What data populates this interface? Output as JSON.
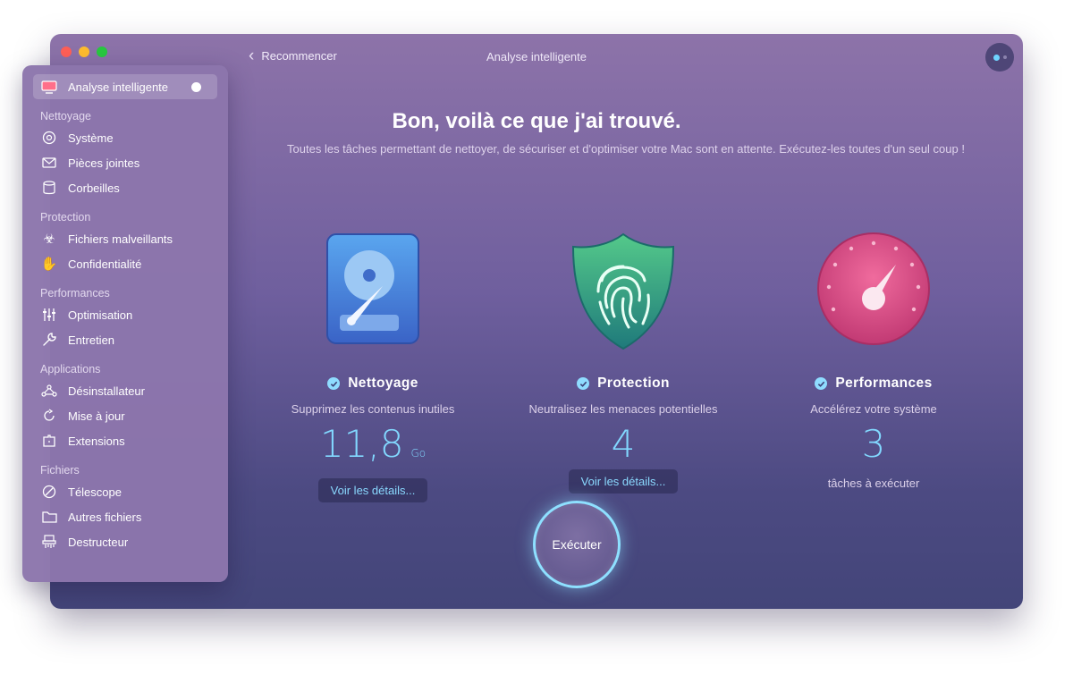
{
  "window": {
    "title": "Analyse intelligente",
    "back_label": "Recommencer"
  },
  "sidebar": {
    "active": {
      "label": "Analyse intelligente",
      "icon": "monitor-icon"
    },
    "sections": [
      {
        "label": "Nettoyage",
        "items": [
          {
            "label": "Système",
            "icon": "system-icon"
          },
          {
            "label": "Pièces jointes",
            "icon": "mail-icon"
          },
          {
            "label": "Corbeilles",
            "icon": "trash-icon"
          }
        ]
      },
      {
        "label": "Protection",
        "items": [
          {
            "label": "Fichiers malveillants",
            "icon": "biohazard-icon"
          },
          {
            "label": "Confidentialité",
            "icon": "hand-icon"
          }
        ]
      },
      {
        "label": "Performances",
        "items": [
          {
            "label": "Optimisation",
            "icon": "sliders-icon"
          },
          {
            "label": "Entretien",
            "icon": "wrench-icon"
          }
        ]
      },
      {
        "label": "Applications",
        "items": [
          {
            "label": "Désinstallateur",
            "icon": "uninstaller-icon"
          },
          {
            "label": "Mise à jour",
            "icon": "update-icon"
          },
          {
            "label": "Extensions",
            "icon": "extensions-icon"
          }
        ]
      },
      {
        "label": "Fichiers",
        "items": [
          {
            "label": "Télescope",
            "icon": "telescope-icon"
          },
          {
            "label": "Autres fichiers",
            "icon": "folder-icon"
          },
          {
            "label": "Destructeur",
            "icon": "shredder-icon"
          }
        ]
      }
    ]
  },
  "main": {
    "heading": "Bon, voilà ce que j'ai trouvé.",
    "subheading": "Toutes les tâches permettant de nettoyer, de sécuriser et d'optimiser votre Mac sont en attente. Exécutez-les toutes d'un seul coup !",
    "cards": [
      {
        "title": "Nettoyage",
        "description": "Supprimez les contenus inutiles",
        "value": "11,8",
        "unit": "Go",
        "button": "Voir les détails..."
      },
      {
        "title": "Protection",
        "description": "Neutralisez les menaces potentielles",
        "value": "4",
        "button": "Voir les détails..."
      },
      {
        "title": "Performances",
        "description": "Accélérez votre système",
        "value": "3",
        "footer": "tâches à exécuter"
      }
    ],
    "run_label": "Exécuter"
  },
  "colors": {
    "accent": "#82d8ff",
    "window_top": "#8d73a9",
    "window_bottom": "#434579"
  }
}
